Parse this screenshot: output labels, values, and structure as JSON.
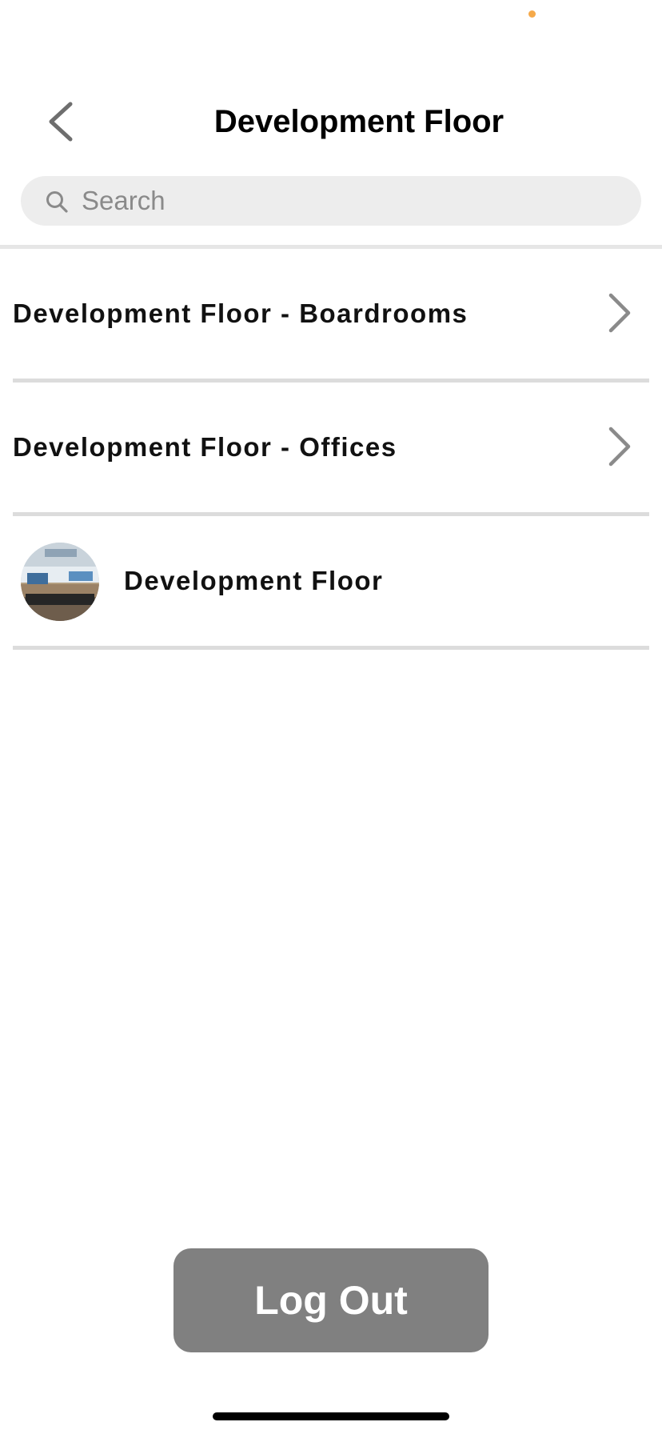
{
  "nav": {
    "title": "Development Floor",
    "back_icon": "chevron-left-icon"
  },
  "search": {
    "placeholder": "Search",
    "value": "",
    "icon": "search-icon"
  },
  "list": {
    "items": [
      {
        "label": "Development Floor - Boardrooms",
        "icon": "chevron-right-icon"
      },
      {
        "label": "Development Floor - Offices",
        "icon": "chevron-right-icon"
      },
      {
        "label": "Development Floor",
        "thumbnail": "panorama-thumbnail"
      }
    ]
  },
  "footer": {
    "logout_label": "Log Out"
  },
  "colors": {
    "status_dot": "#f5a94a",
    "search_bg": "#ededed",
    "divider": "#dcdcdc",
    "logout_bg": "#808080",
    "chevron": "#8a8a8a"
  }
}
